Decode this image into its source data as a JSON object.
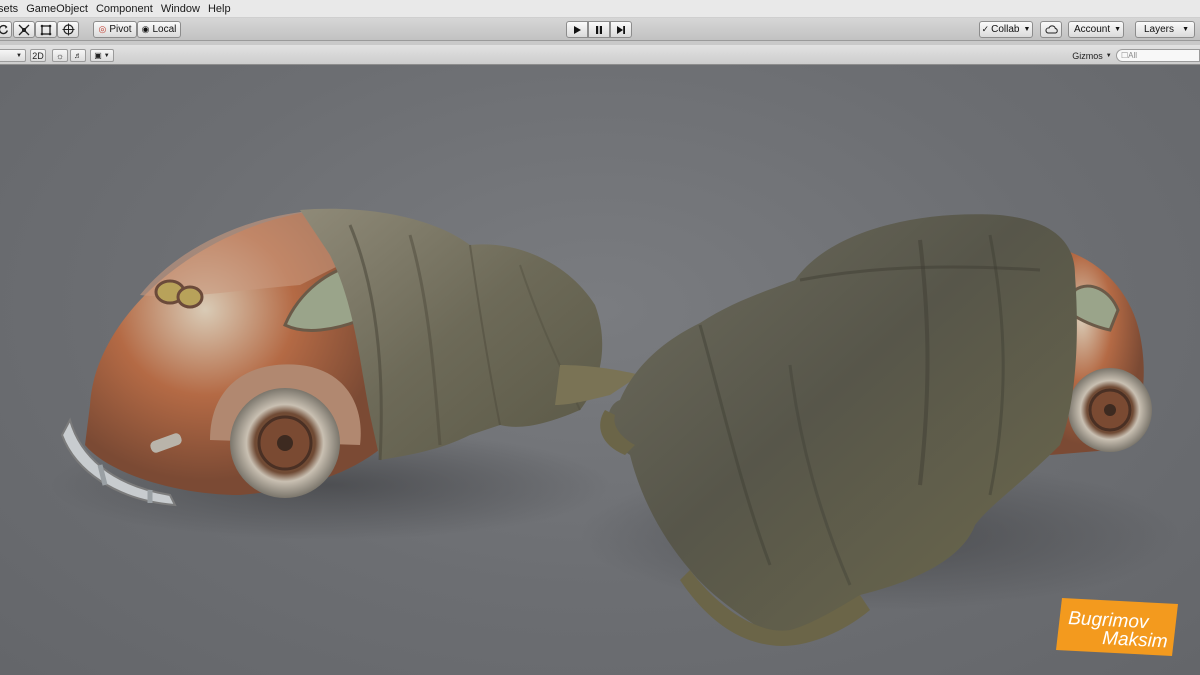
{
  "menu": {
    "items": [
      "sets",
      "GameObject",
      "Component",
      "Window",
      "Help"
    ]
  },
  "toolbar": {
    "pivot_label": "Pivot",
    "local_label": "Local",
    "collab_label": "Collab",
    "account_label": "Account",
    "layers_label": "Layers",
    "tools": [
      "rotate-tool",
      "scale-tool",
      "rect-tool",
      "transform-tool"
    ],
    "playback": [
      "play",
      "pause",
      "step"
    ]
  },
  "scenebar": {
    "mode_2d_label": "2D",
    "gizmos_label": "Gizmos",
    "search_placeholder": "☐All"
  },
  "scene": {
    "objects": [
      "rusty-beetle-car-with-cloth",
      "beetle-car-under-cloth"
    ]
  },
  "watermark": {
    "line1": "Bugrimov",
    "line2": "Maksim",
    "color": "#f39a1e"
  },
  "colors": {
    "viewport_bg": "#6e7074",
    "toolbar_bg": "#c8c8c8",
    "menubar_bg": "#e9e9e9"
  }
}
